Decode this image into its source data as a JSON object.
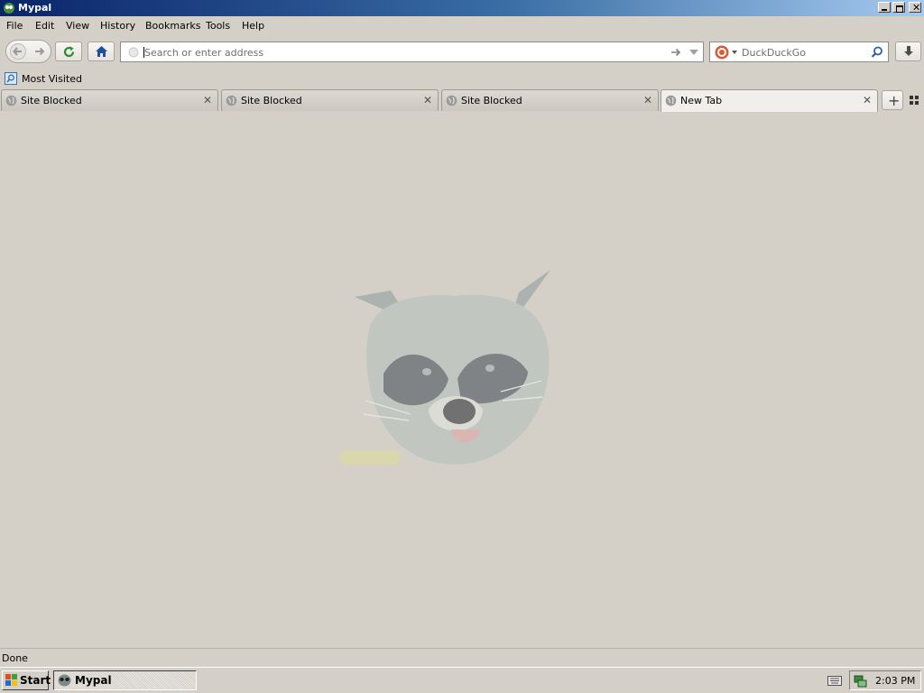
{
  "window": {
    "title": "Mypal"
  },
  "menu": [
    "File",
    "Edit",
    "View",
    "History",
    "Bookmarks",
    "Tools",
    "Help"
  ],
  "address": {
    "placeholder": "Search or enter address"
  },
  "search": {
    "placeholder": "DuckDuckGo"
  },
  "bookmarks": {
    "most_visited": "Most Visited"
  },
  "tabs": [
    {
      "title": "Site Blocked"
    },
    {
      "title": "Site Blocked"
    },
    {
      "title": "Site Blocked"
    },
    {
      "title": "New Tab"
    }
  ],
  "status": {
    "text": "Done"
  },
  "taskbar": {
    "start_label": "Start",
    "app_label": "Mypal",
    "clock": "2:03 PM"
  },
  "colors": {
    "titlebar_start": "#0a246a",
    "titlebar_end": "#a6caf0",
    "chrome": "#d4d0c8"
  },
  "icons": {
    "back": "back-arrow-icon",
    "forward": "forward-arrow-icon",
    "reload": "reload-icon",
    "home": "home-icon",
    "download": "download-icon",
    "search": "magnifier-icon"
  }
}
